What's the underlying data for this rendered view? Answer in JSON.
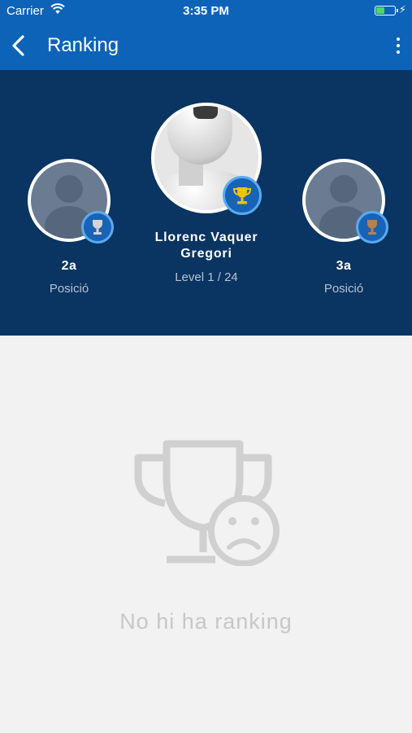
{
  "status_bar": {
    "carrier": "Carrier",
    "time": "3:35 PM"
  },
  "nav": {
    "title": "Ranking",
    "back_icon": "chevron-left-icon",
    "more_icon": "more-vertical-icon"
  },
  "podium": {
    "first": {
      "name": "Llorenc Vaquer Gregori",
      "name_line1": "Llorenc Vaquer",
      "name_line2": "Gregori",
      "level": "Level 1 / 24",
      "badge_icon": "gold-trophy-icon"
    },
    "second": {
      "place": "2a",
      "label": "Posició",
      "badge_icon": "silver-trophy-icon"
    },
    "third": {
      "place": "3a",
      "label": "Posició",
      "badge_icon": "bronze-trophy-icon"
    }
  },
  "empty_state": {
    "icon": "sad-trophy-icon",
    "message": "No hi ha ranking"
  },
  "colors": {
    "header_blue": "#0d63b8",
    "podium_navy": "#0a3461",
    "background": "#f2f2f2",
    "gold": "#f2c400",
    "silver": "#d4d4d4",
    "bronze": "#b9804a"
  }
}
